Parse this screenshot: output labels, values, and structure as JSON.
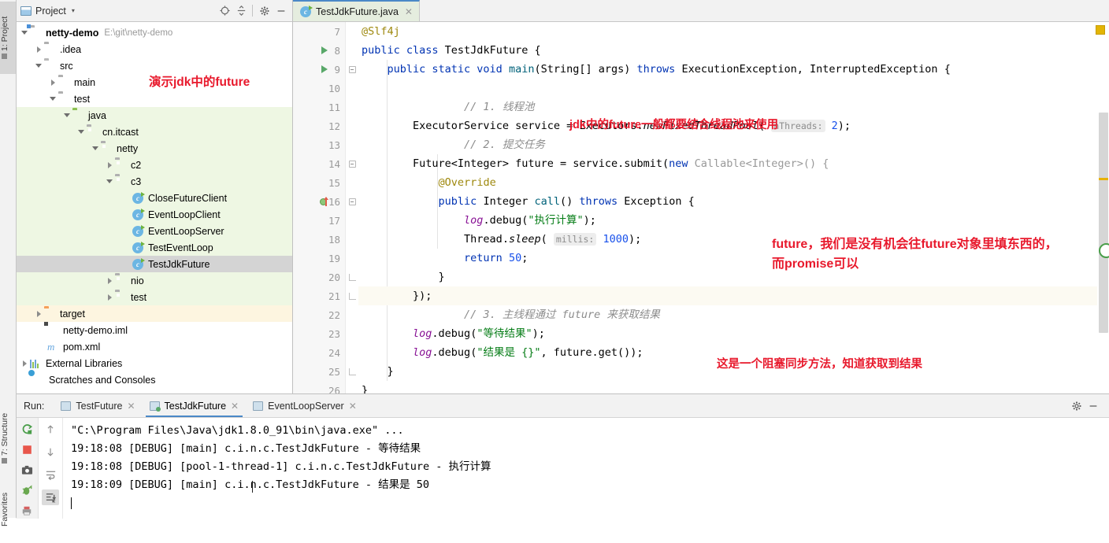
{
  "left_strip": {
    "tabs": [
      {
        "label": "1: Project",
        "selected": true
      },
      {
        "label": "7: Structure",
        "selected": false
      },
      {
        "label": "Favorites",
        "selected": false
      }
    ]
  },
  "project_panel": {
    "title": "Project",
    "caret": "▾",
    "icons": [
      "locate-icon",
      "collapse-all-icon",
      "gear-icon",
      "minimize-icon"
    ],
    "annotation": "演示jdk中的future",
    "tree": [
      {
        "depth": 0,
        "arrow": "down",
        "icon": "module-folder",
        "label": "netty-demo",
        "bold": true,
        "path": "E:\\git\\netty-demo",
        "bg": "none"
      },
      {
        "depth": 1,
        "arrow": "right",
        "icon": "folder",
        "label": ".idea",
        "bg": "none"
      },
      {
        "depth": 1,
        "arrow": "down",
        "icon": "folder",
        "label": "src",
        "bg": "none"
      },
      {
        "depth": 2,
        "arrow": "right",
        "icon": "folder",
        "label": "main",
        "bg": "none"
      },
      {
        "depth": 2,
        "arrow": "down",
        "icon": "folder",
        "label": "test",
        "bg": "none"
      },
      {
        "depth": 3,
        "arrow": "down",
        "icon": "folder-green",
        "label": "java",
        "bg": "green"
      },
      {
        "depth": 4,
        "arrow": "down",
        "icon": "folder-package",
        "label": "cn.itcast",
        "bg": "green"
      },
      {
        "depth": 5,
        "arrow": "down",
        "icon": "folder-package",
        "label": "netty",
        "bg": "green"
      },
      {
        "depth": 6,
        "arrow": "right",
        "icon": "folder-package",
        "label": "c2",
        "bg": "green"
      },
      {
        "depth": 6,
        "arrow": "down",
        "icon": "folder-package",
        "label": "c3",
        "bg": "green"
      },
      {
        "depth": 7,
        "arrow": "none",
        "icon": "java-class",
        "label": "CloseFutureClient",
        "bg": "green"
      },
      {
        "depth": 7,
        "arrow": "none",
        "icon": "java-class",
        "label": "EventLoopClient",
        "bg": "green"
      },
      {
        "depth": 7,
        "arrow": "none",
        "icon": "java-class",
        "label": "EventLoopServer",
        "bg": "green"
      },
      {
        "depth": 7,
        "arrow": "none",
        "icon": "java-class",
        "label": "TestEventLoop",
        "bg": "green"
      },
      {
        "depth": 7,
        "arrow": "none",
        "icon": "java-class",
        "label": "TestJdkFuture",
        "bg": "selected"
      },
      {
        "depth": 6,
        "arrow": "right",
        "icon": "folder-package",
        "label": "nio",
        "bg": "green"
      },
      {
        "depth": 6,
        "arrow": "right",
        "icon": "folder-package",
        "label": "test",
        "bg": "green"
      },
      {
        "depth": 1,
        "arrow": "right",
        "icon": "folder-orange",
        "label": "target",
        "bg": "orange"
      },
      {
        "depth": 2,
        "arrow": "none",
        "icon": "iml-file",
        "label": "netty-demo.iml",
        "bg": "none"
      },
      {
        "depth": 2,
        "arrow": "none",
        "icon": "maven-file",
        "label": "pom.xml",
        "bg": "none"
      },
      {
        "depth": 0,
        "arrow": "right",
        "icon": "libraries",
        "label": "External Libraries",
        "bg": "none"
      },
      {
        "depth": 0,
        "arrow": "none",
        "icon": "scratches",
        "label": "Scratches and Consoles",
        "bg": "none"
      }
    ]
  },
  "editor": {
    "tab": {
      "label": "TestJdkFuture.java",
      "close": "✕",
      "icon": "java-class-icon"
    },
    "first_line_number": 7,
    "lines": [
      {
        "n": 7,
        "run": false,
        "fold": "none",
        "text": "@Slf4j"
      },
      {
        "n": 8,
        "run": true,
        "fold": "none",
        "text": "public class TestJdkFuture {"
      },
      {
        "n": 9,
        "run": true,
        "fold": "open",
        "text": "    public static void main(String[] args) throws ExecutionException, InterruptedException {"
      },
      {
        "n": 10,
        "run": false,
        "fold": "none",
        "text": ""
      },
      {
        "n": 11,
        "run": false,
        "fold": "none",
        "text": "        // 1. 线程池"
      },
      {
        "n": 12,
        "run": false,
        "fold": "none",
        "text": "        ExecutorService service = Executors.newFixedThreadPool( nThreads: 2);"
      },
      {
        "n": 13,
        "run": false,
        "fold": "none",
        "text": "        // 2. 提交任务"
      },
      {
        "n": 14,
        "run": false,
        "fold": "open",
        "text": "        Future<Integer> future = service.submit(new Callable<Integer>() {"
      },
      {
        "n": 15,
        "run": false,
        "fold": "none",
        "text": "            @Override"
      },
      {
        "n": 16,
        "run": false,
        "fold": "open",
        "text": "            public Integer call() throws Exception {",
        "override": true
      },
      {
        "n": 17,
        "run": false,
        "fold": "none",
        "text": "                log.debug(\"执行计算\");"
      },
      {
        "n": 18,
        "run": false,
        "fold": "none",
        "text": "                Thread.sleep( millis: 1000);"
      },
      {
        "n": 19,
        "run": false,
        "fold": "none",
        "text": "                return 50;"
      },
      {
        "n": 20,
        "run": false,
        "fold": "end",
        "text": "            }"
      },
      {
        "n": 21,
        "run": false,
        "fold": "end",
        "text": "        });",
        "highlight": true
      },
      {
        "n": 22,
        "run": false,
        "fold": "none",
        "text": "        // 3. 主线程通过 future 来获取结果"
      },
      {
        "n": 23,
        "run": false,
        "fold": "none",
        "text": "        log.debug(\"等待结果\");"
      },
      {
        "n": 24,
        "run": false,
        "fold": "none",
        "text": "        log.debug(\"结果是 {}\", future.get());"
      },
      {
        "n": 25,
        "run": false,
        "fold": "end",
        "text": "    }"
      },
      {
        "n": 26,
        "run": false,
        "fold": "none",
        "text": "}"
      }
    ],
    "annotations": [
      {
        "id": "ann-threadpool",
        "text": "jdk中的future一般都要结合线程池来使用"
      },
      {
        "id": "ann-future-promise",
        "line1": "future，我们是没有机会往future对象里填东西的，",
        "line2": "而promise可以"
      },
      {
        "id": "ann-blocking",
        "text": "这是一个阻塞同步方法，知道获取到结果"
      }
    ],
    "inspection_badge_color": "#e3b505"
  },
  "run_window": {
    "label": "Run:",
    "tabs": [
      {
        "label": "TestFuture",
        "active": false,
        "close": "✕",
        "live": false
      },
      {
        "label": "TestJdkFuture",
        "active": true,
        "close": "✕",
        "live": true
      },
      {
        "label": "EventLoopServer",
        "active": false,
        "close": "✕",
        "live": false
      }
    ],
    "right_icons": [
      "gear-icon",
      "minimize-icon"
    ],
    "toolbar_left": [
      "rerun-icon",
      "stop-icon",
      "camera-icon",
      "debug-icon",
      "print-icon"
    ],
    "toolbar_right": [
      "up-arrow-icon",
      "down-arrow-icon",
      "soft-wrap-icon",
      "scroll-to-end-icon"
    ],
    "console_lines": [
      {
        "type": "command",
        "text": "\"C:\\Program Files\\Java\\jdk1.8.0_91\\bin\\java.exe\" ..."
      },
      {
        "type": "log",
        "text": "19:18:08 [DEBUG] [main] c.i.n.c.TestJdkFuture - 等待结果"
      },
      {
        "type": "log",
        "text": "19:18:08 [DEBUG] [pool-1-thread-1] c.i.n.c.TestJdkFuture - 执行计算"
      },
      {
        "type": "log",
        "text": "19:18:09 [DEBUG] [main] c.i.n.c.TestJdkFuture - 结果是 50"
      }
    ]
  },
  "colors": {
    "annotation_red": "#e8192c",
    "keyword_blue": "#0033b3",
    "string_green": "#067d17",
    "number_blue": "#1750eb",
    "comment_gray": "#8c8c8c",
    "annotation_gold": "#9e880d",
    "field_purple": "#871094",
    "test_source_bg": "#eef7e3",
    "target_bg": "#fdf5e0",
    "selection_gray": "#d4d4d4"
  }
}
